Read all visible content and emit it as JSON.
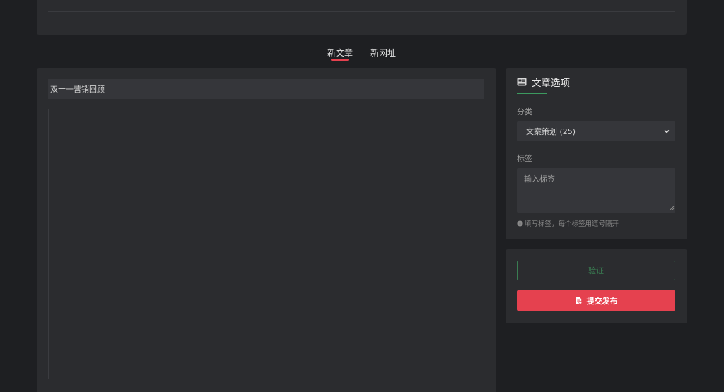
{
  "tabs": [
    {
      "label": "新文章",
      "active": true
    },
    {
      "label": "新网址",
      "active": false
    }
  ],
  "editor": {
    "title_value": "双十一营销回顾",
    "body_value": ""
  },
  "options": {
    "title": "文章选项",
    "category_label": "分类",
    "category_selected": "文案策划  (25)",
    "tags_label": "标签",
    "tags_placeholder": "输入标签",
    "tags_hint": "填写标签，每个标签用逗号隔开"
  },
  "actions": {
    "verify_label": "验证",
    "submit_label": "提交发布"
  },
  "colors": {
    "accent_red": "#e5414f",
    "accent_green": "#3c9a5f",
    "panel_bg": "#2b2c2f",
    "page_bg": "#1e1f22"
  },
  "icons": {
    "options_header": "newspaper-icon",
    "submit": "publish-doc-icon",
    "hint": "info-icon",
    "select": "chevron-down-icon"
  }
}
